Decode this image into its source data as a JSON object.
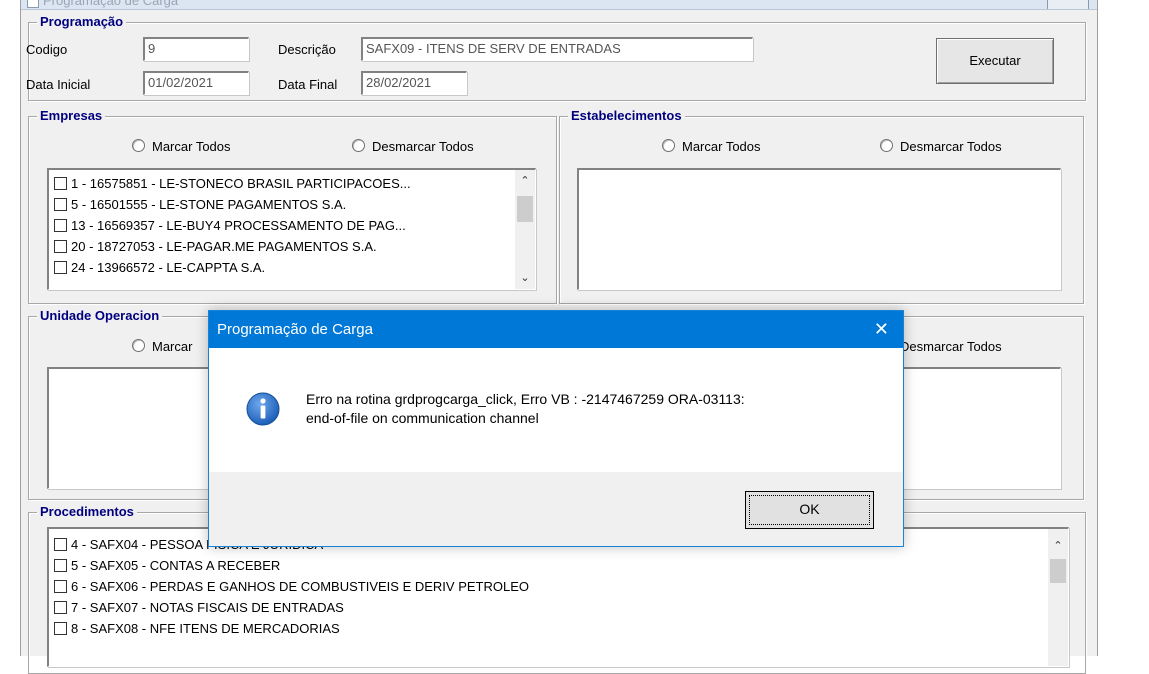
{
  "window": {
    "title": "Programação de Carga"
  },
  "programacao": {
    "title": "Programação",
    "codigo_label": "Codigo",
    "codigo_value": "9",
    "descricao_label": "Descrição",
    "descricao_value": "SAFX09 - ITENS DE SERV DE ENTRADAS",
    "data_inicial_label": "Data Inicial",
    "data_inicial_value": "01/02/2021",
    "data_final_label": "Data Final",
    "data_final_value": "28/02/2021",
    "executar_label": "Executar"
  },
  "empresas": {
    "title": "Empresas",
    "marcar_todos": "Marcar Todos",
    "desmarcar_todos": "Desmarcar Todos",
    "items": [
      "1 - 16575851 - LE-STONECO BRASIL PARTICIPACOES...",
      "5 - 16501555 - LE-STONE PAGAMENTOS S.A.",
      "13 - 16569357 - LE-BUY4 PROCESSAMENTO DE PAG...",
      "20 - 18727053 - LE-PAGAR.ME PAGAMENTOS S.A.",
      "24 - 13966572 - LE-CAPPTA S.A."
    ]
  },
  "estabelecimentos": {
    "title": "Estabelecimentos",
    "marcar_todos": "Marcar Todos",
    "desmarcar_todos": "Desmarcar Todos"
  },
  "unidade": {
    "title": "Unidade Operacion",
    "marcar_todos": "Marcar",
    "desmarcar_todos": "Desmarcar Todos"
  },
  "procedimentos": {
    "title": "Procedimentos",
    "items": [
      "4 - SAFX04 - PESSOA FISICA E JURIDICA",
      "5 - SAFX05 - CONTAS A RECEBER",
      "6 - SAFX06 - PERDAS E GANHOS DE COMBUSTIVEIS E DERIV PETROLEO",
      "7 - SAFX07 - NOTAS FISCAIS DE ENTRADAS",
      "8 - SAFX08 - NFE ITENS DE MERCADORIAS"
    ]
  },
  "dialog": {
    "title": "Programação de Carga",
    "close_glyph": "✕",
    "message_line1": "Erro na rotina grdprogcarga_click, Erro VB : -2147467259 ORA-03113:",
    "message_line2": "end-of-file on communication channel",
    "ok_label": "OK",
    "icon": "info-icon"
  },
  "colors": {
    "group_title": "#00007f",
    "dialog_titlebar": "#0078d7",
    "info_icon": "#1c5fb8"
  }
}
